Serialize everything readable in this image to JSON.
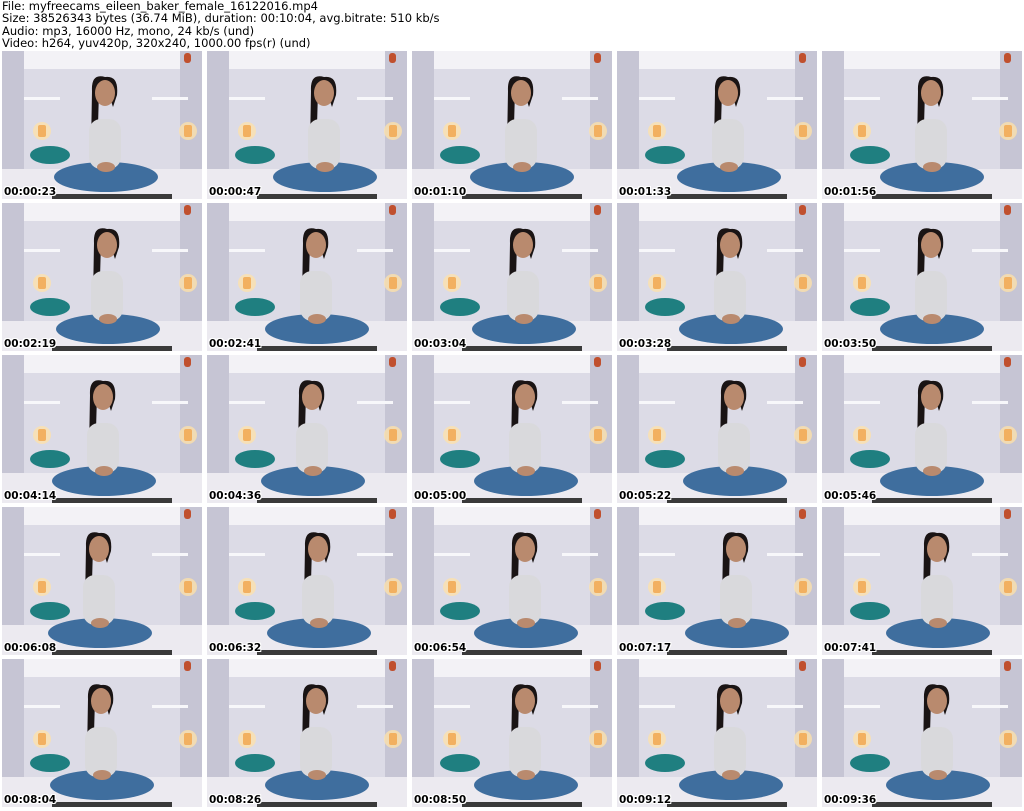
{
  "header": {
    "file_line": "File: myfreecams_eileen_baker_female_16122016.mp4",
    "size_line": "Size: 38526343 bytes (36.74 MiB), duration: 00:10:04, avg.bitrate: 510 kb/s",
    "audio_line": "Audio: mp3, 16000 Hz, mono, 24 kb/s (und)",
    "video_line": "Video: h264, yuv420p, 320x240, 1000.00 fps(r) (und)"
  },
  "colors": {
    "wall": "#dcdbe6",
    "wall_shadow": "#c6c5d4",
    "candle": "#f2b060",
    "candle_glow": "#ffe2a8",
    "bed": "#eceaf0",
    "pillow": "#1f7f80",
    "hair": "#1a1414",
    "skin": "#b98a6e",
    "top": "#d9d9dc",
    "jeans": "#3f6e9e",
    "vase": "#c0502e",
    "timestamp_text": "#000000",
    "timestamp_outline": "#ffffff"
  },
  "thumbnails": [
    {
      "time": "00:00:23"
    },
    {
      "time": "00:00:47"
    },
    {
      "time": "00:01:10"
    },
    {
      "time": "00:01:33"
    },
    {
      "time": "00:01:56"
    },
    {
      "time": "00:02:19"
    },
    {
      "time": "00:02:41"
    },
    {
      "time": "00:03:04"
    },
    {
      "time": "00:03:28"
    },
    {
      "time": "00:03:50"
    },
    {
      "time": "00:04:14"
    },
    {
      "time": "00:04:36"
    },
    {
      "time": "00:05:00"
    },
    {
      "time": "00:05:22"
    },
    {
      "time": "00:05:46"
    },
    {
      "time": "00:06:08"
    },
    {
      "time": "00:06:32"
    },
    {
      "time": "00:06:54"
    },
    {
      "time": "00:07:17"
    },
    {
      "time": "00:07:41"
    },
    {
      "time": "00:08:04"
    },
    {
      "time": "00:08:26"
    },
    {
      "time": "00:08:50"
    },
    {
      "time": "00:09:12"
    },
    {
      "time": "00:09:36"
    }
  ]
}
